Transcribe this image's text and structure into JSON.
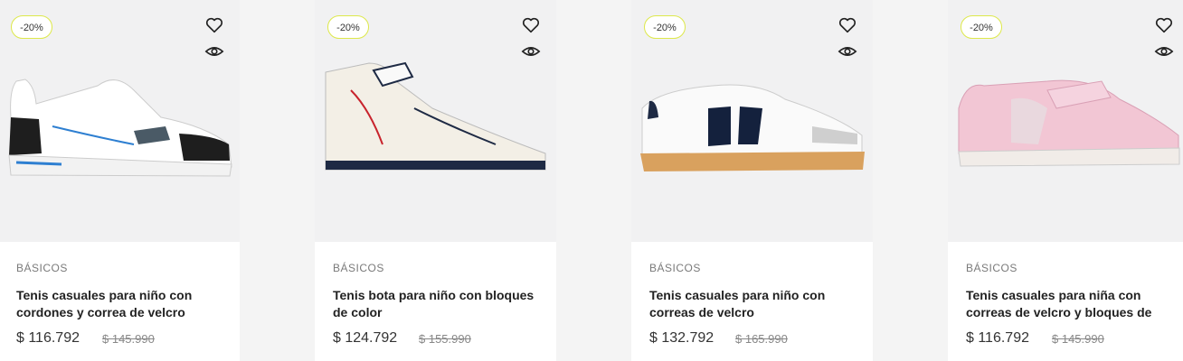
{
  "products": [
    {
      "discount": "-20%",
      "category": "BÁSICOS",
      "title": "Tenis casuales para niño con cordones y correa de velcro",
      "price": "$ 116.792",
      "old_price": "$ 145.990"
    },
    {
      "discount": "-20%",
      "category": "BÁSICOS",
      "title": "Tenis bota para niño con bloques de color",
      "price": "$ 124.792",
      "old_price": "$ 155.990"
    },
    {
      "discount": "-20%",
      "category": "BÁSICOS",
      "title": "Tenis casuales para niño con correas de velcro",
      "price": "$ 132.792",
      "old_price": "$ 165.990"
    },
    {
      "discount": "-20%",
      "category": "BÁSICOS",
      "title": "Tenis casuales para niña con correas de velcro y bloques de",
      "price": "$ 116.792",
      "old_price": "$ 145.990"
    }
  ],
  "icons": {
    "favorite": "heart-icon",
    "quick_view": "eye-icon"
  }
}
